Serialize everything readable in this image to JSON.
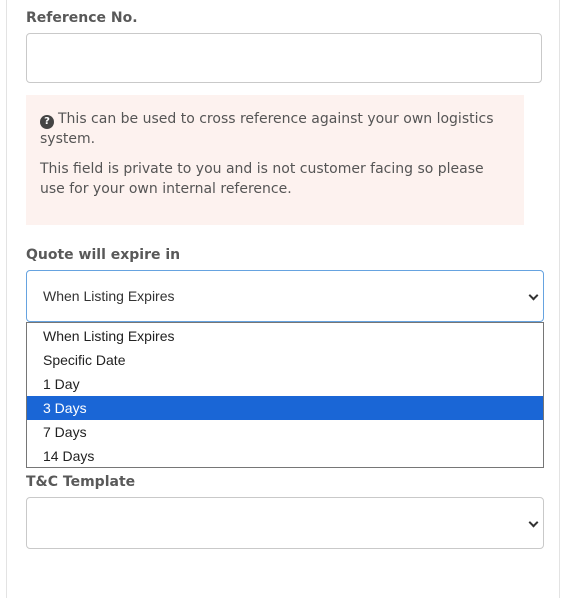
{
  "reference": {
    "label": "Reference No.",
    "value": ""
  },
  "info_note": {
    "icon": "question-circle-icon",
    "line1": "This can be used to cross reference against your own logistics system.",
    "line2": "This field is private to you and is not customer facing so please use for your own internal reference."
  },
  "quote_expiry": {
    "label": "Quote will expire in",
    "selected": "When Listing Expires",
    "highlighted": "3 Days",
    "options": [
      "When Listing Expires",
      "Specific Date",
      "1 Day",
      "3 Days",
      "7 Days",
      "14 Days"
    ]
  },
  "tc_template": {
    "label": "T&C Template",
    "selected": ""
  },
  "colors": {
    "highlight": "#1a66d6",
    "note_background": "#fdf2ef",
    "focus_border": "#66a3e0"
  }
}
